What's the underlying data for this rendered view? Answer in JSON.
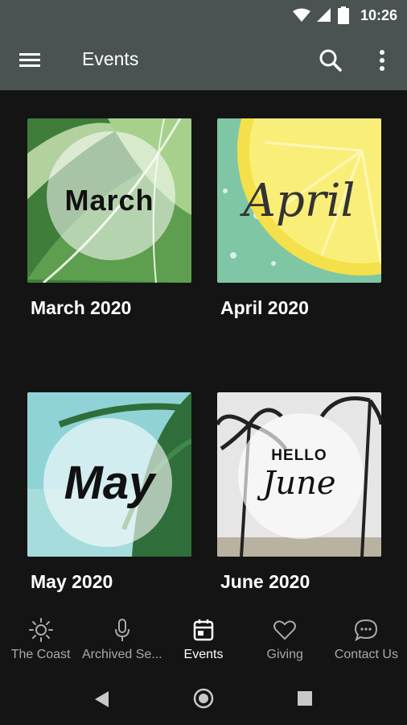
{
  "status_bar": {
    "time": "10:26"
  },
  "app_bar": {
    "title": "Events"
  },
  "events": [
    {
      "title": "March 2020",
      "thumb_text": "March"
    },
    {
      "title": "April 2020",
      "thumb_text": "April"
    },
    {
      "title": "May 2020",
      "thumb_text": "May"
    },
    {
      "title": "June 2020",
      "thumb_text_top": "HELLO",
      "thumb_text": "June"
    }
  ],
  "bottom_nav": {
    "items": [
      {
        "label": "The Coast",
        "icon": "sun-icon"
      },
      {
        "label": "Archived Se...",
        "icon": "microphone-icon"
      },
      {
        "label": "Events",
        "icon": "calendar-icon",
        "active": true
      },
      {
        "label": "Giving",
        "icon": "heart-icon"
      },
      {
        "label": "Contact Us",
        "icon": "chat-bubble-icon"
      }
    ]
  },
  "colors": {
    "app_bar": "#4a5252",
    "background": "#141414",
    "nav_inactive": "#a9a9a9"
  }
}
